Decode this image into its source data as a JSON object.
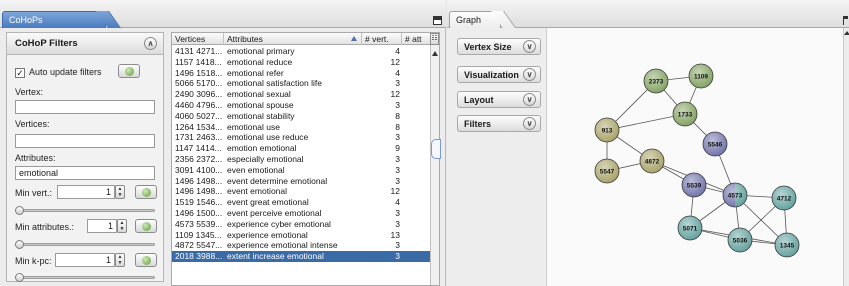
{
  "left_window": {
    "tab_title": "CoHoPs"
  },
  "filters": {
    "title": "CoHoP Filters",
    "auto_update_label": "Auto update filters",
    "auto_update_checked": true,
    "vertex_label": "Vertex:",
    "vertex_value": "",
    "vertices_label": "Vertices:",
    "vertices_value": "",
    "attributes_label": "Attributes:",
    "attributes_value": "emotional",
    "min_vert_label": "Min vert.:",
    "min_vert_value": "1",
    "min_attributes_label": "Min attributes.:",
    "min_attributes_value": "1",
    "min_kpc_label": "Min k-pc:",
    "min_kpc_value": "1"
  },
  "table": {
    "columns": [
      "Vertices",
      "Attributes",
      "# vert.",
      "# att"
    ],
    "selected_index": 19,
    "rows": [
      [
        "4131 4271...",
        "emotional primary",
        "4"
      ],
      [
        "1157 1418...",
        "emotional reduce",
        "12"
      ],
      [
        "1496 1518...",
        "emotional refer",
        "4"
      ],
      [
        "5066 5170...",
        "emotional satisfaction life",
        "3"
      ],
      [
        "2490 3096...",
        "emotional sexual",
        "12"
      ],
      [
        "4460 4796...",
        "emotional spouse",
        "3"
      ],
      [
        "4060 5027...",
        "emotional stability",
        "8"
      ],
      [
        "1264 1534...",
        "emotional use",
        "8"
      ],
      [
        "1731 2463...",
        "emotional use reduce",
        "3"
      ],
      [
        "1147 1414...",
        "emotion emotional",
        "9"
      ],
      [
        "2356 2372...",
        "especially emotional",
        "3"
      ],
      [
        "3091 4100...",
        "even emotional",
        "3"
      ],
      [
        "1496 1498...",
        "event determine emotional",
        "3"
      ],
      [
        "1496 1498...",
        "event emotional",
        "12"
      ],
      [
        "1519 1546...",
        "event great emotional",
        "4"
      ],
      [
        "1496 1500...",
        "event perceive emotional",
        "3"
      ],
      [
        "4573 5539...",
        "experience cyber emotional",
        "3"
      ],
      [
        "1109 1345...",
        "experience emotional",
        "13"
      ],
      [
        "4872 5547...",
        "experience emotional intense",
        "3"
      ],
      [
        "2018 3988...",
        "extent increase emotional",
        "3"
      ]
    ]
  },
  "right_window": {
    "tab_title": "Graph",
    "buttons": [
      "Vertex Size",
      "Visualization",
      "Layout",
      "Filters"
    ]
  },
  "graph": {
    "nodes": [
      {
        "id": "2373",
        "color": "#7fa05e",
        "split": null
      },
      {
        "id": "1109",
        "color": "#7fa05e",
        "split": null
      },
      {
        "id": "1733",
        "color": "#7fa05e",
        "split": null
      },
      {
        "id": "913",
        "color": "#a6a064",
        "split": null
      },
      {
        "id": "5546",
        "color": "#6d6fa8",
        "split": null
      },
      {
        "id": "4872",
        "color": "#a6a064",
        "split": null
      },
      {
        "id": "5547",
        "color": "#a6a064",
        "split": null
      },
      {
        "id": "5539",
        "color": "#6d6fa8",
        "split": null
      },
      {
        "id": "4573",
        "color": "#6d6fa8",
        "split": "#5f9f9c"
      },
      {
        "id": "4712",
        "color": "#5f9f9c",
        "split": null
      },
      {
        "id": "5071",
        "color": "#5f9f9c",
        "split": null
      },
      {
        "id": "5036",
        "color": "#5f9f9c",
        "split": null
      },
      {
        "id": "1345",
        "color": "#5f9f9c",
        "split": null
      }
    ],
    "edges": [
      [
        "2373",
        "1109"
      ],
      [
        "2373",
        "1733"
      ],
      [
        "1109",
        "1733"
      ],
      [
        "2373",
        "913"
      ],
      [
        "1733",
        "913"
      ],
      [
        "1733",
        "5546"
      ],
      [
        "913",
        "4872"
      ],
      [
        "913",
        "5547"
      ],
      [
        "5547",
        "4872"
      ],
      [
        "4872",
        "5539"
      ],
      [
        "4872",
        "4573"
      ],
      [
        "5546",
        "4573"
      ],
      [
        "5539",
        "4573"
      ],
      [
        "5539",
        "5071"
      ],
      [
        "4573",
        "4712"
      ],
      [
        "4573",
        "5071"
      ],
      [
        "4573",
        "5036"
      ],
      [
        "4573",
        "1345"
      ],
      [
        "4712",
        "5036"
      ],
      [
        "4712",
        "1345"
      ],
      [
        "5071",
        "5036"
      ],
      [
        "5036",
        "1345"
      ],
      [
        "5071",
        "1345"
      ]
    ]
  }
}
